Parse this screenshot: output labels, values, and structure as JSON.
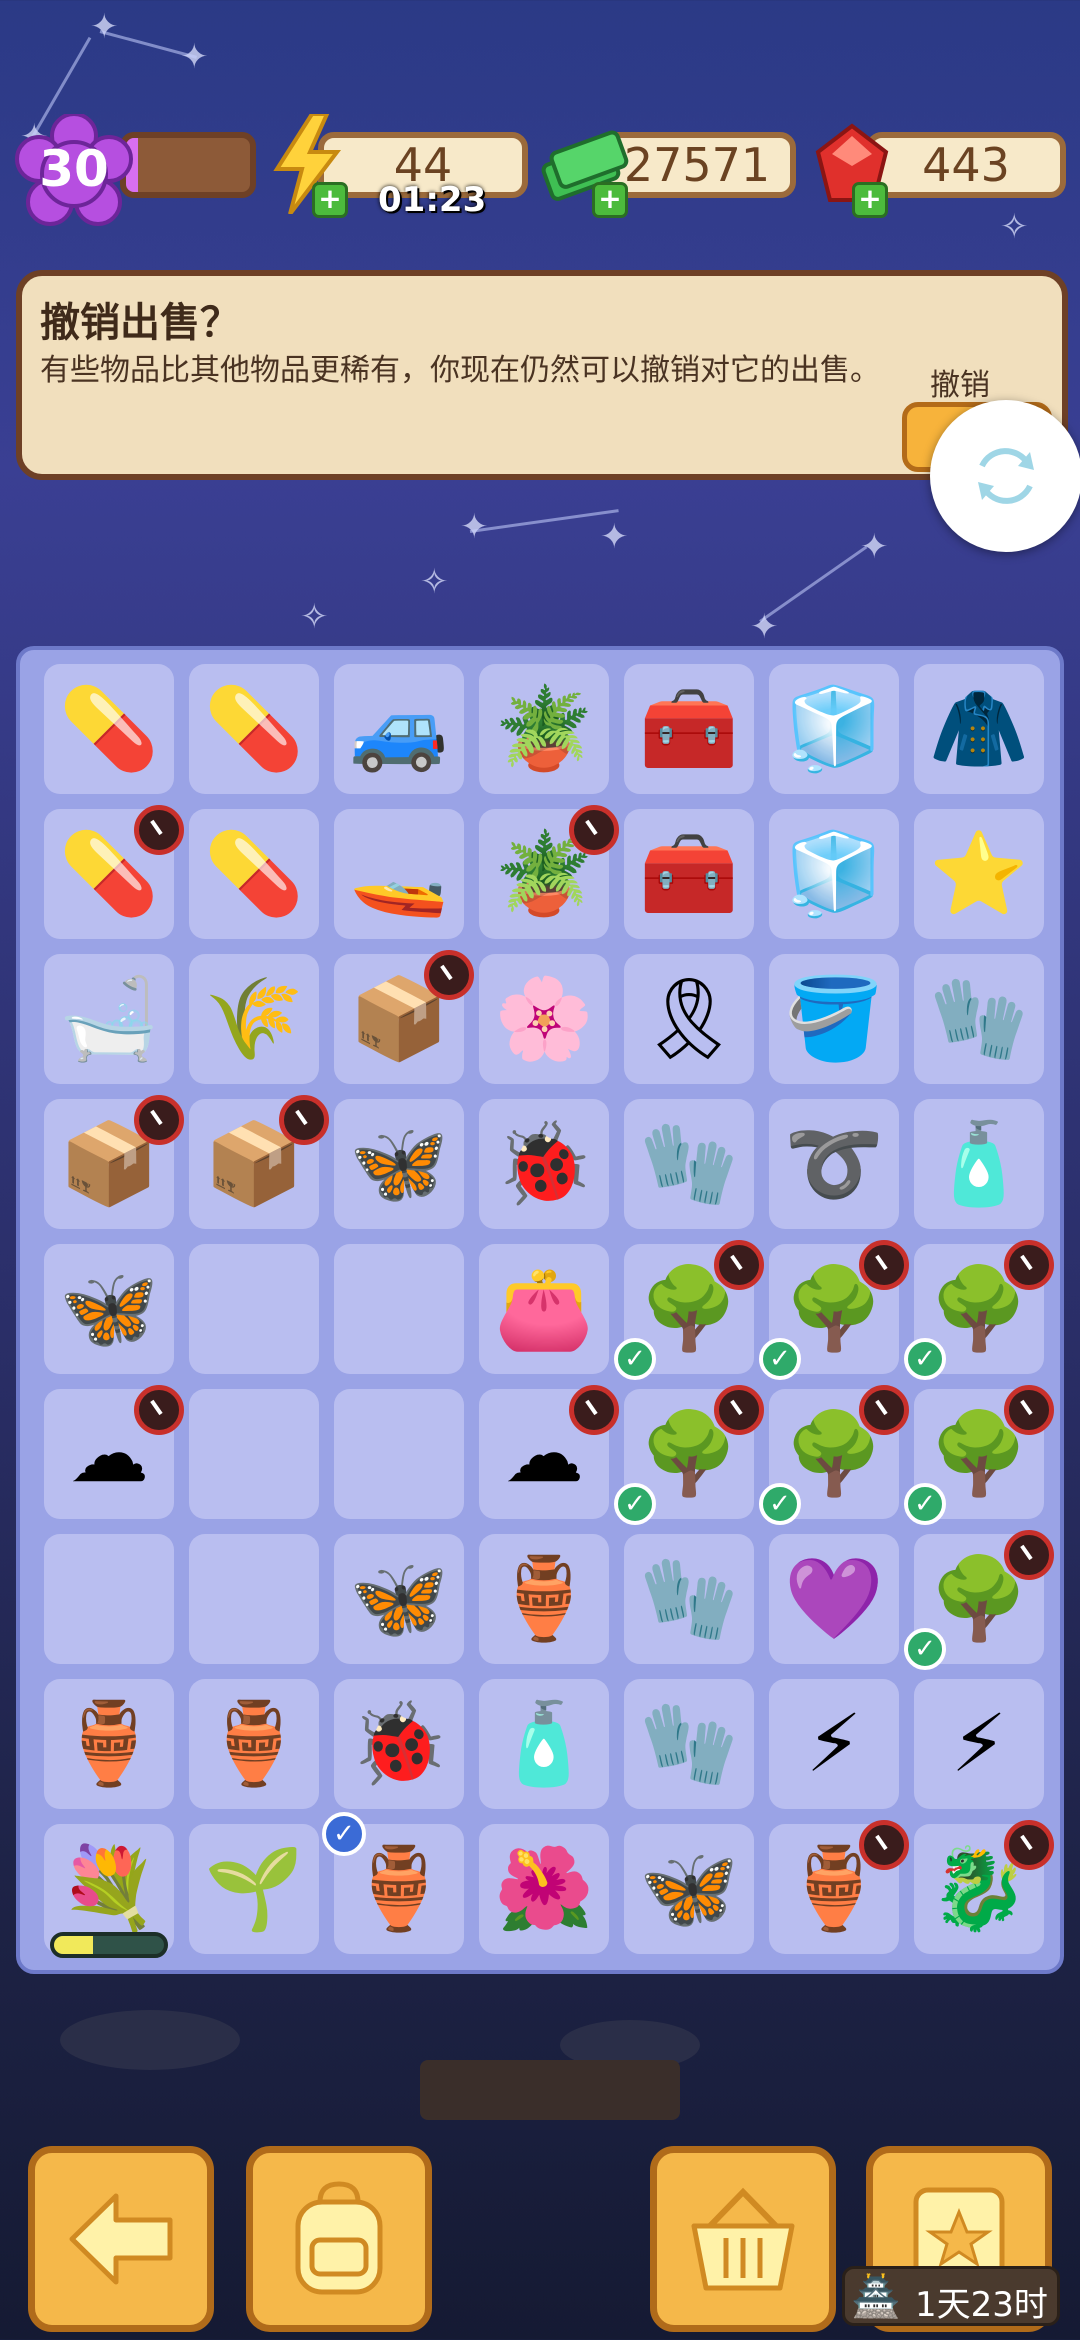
{
  "hud": {
    "level": "30",
    "level_progress_pct": 10,
    "energy": "44",
    "energy_timer": "01:23",
    "cash": "27571",
    "gems": "443"
  },
  "banner": {
    "title": "撤销出售？",
    "text": "有些物品比其他物品更稀有，你现在仍然可以撤销对它的出售。",
    "undo_label": "撤销"
  },
  "board": {
    "rows": [
      [
        {
          "item": "medkit-bottles"
        },
        {
          "item": "medkit-bottles"
        },
        {
          "item": "offroad-jeep"
        },
        {
          "item": "potted-plant"
        },
        {
          "item": "red-toolbox-open"
        },
        {
          "item": "yellow-cooler-open"
        },
        {
          "item": "brown-coat"
        }
      ],
      [
        {
          "item": "medkit-bottles",
          "clock": true
        },
        {
          "item": "medkit-bottles"
        },
        {
          "item": "jet-ski"
        },
        {
          "item": "empty-pot-seeds",
          "clock": true
        },
        {
          "item": "red-toolbox"
        },
        {
          "item": "yellow-cooler"
        },
        {
          "item": "purple-star"
        }
      ],
      [
        {
          "item": "bathtub-cabinet"
        },
        {
          "item": "seed-sack"
        },
        {
          "item": "pottery-crate",
          "clock": true
        },
        {
          "item": "flower-bed-glow"
        },
        {
          "item": "neck-pillow"
        },
        {
          "item": "yellow-bucket"
        },
        {
          "item": "red-gloves"
        }
      ],
      [
        {
          "item": "pottery-box",
          "clock": true
        },
        {
          "item": "pottery-crate-open",
          "clock": true
        },
        {
          "item": "purple-moth"
        },
        {
          "item": "ladybug"
        },
        {
          "item": "red-gloves"
        },
        {
          "item": "garden-hose"
        },
        {
          "item": "spray-bottle"
        }
      ],
      [
        {
          "item": "pale-moth"
        },
        {
          "item": "empty"
        },
        {
          "item": "empty"
        },
        {
          "item": "leather-wallet"
        },
        {
          "item": "bonsai-tree",
          "clock": true,
          "check": true
        },
        {
          "item": "bonsai-tree",
          "clock": true,
          "check": true
        },
        {
          "item": "bonsai-tree",
          "clock": true,
          "check": true
        }
      ],
      [
        {
          "item": "cotton-tree",
          "clock": true
        },
        {
          "item": "empty"
        },
        {
          "item": "empty"
        },
        {
          "item": "cotton-tree",
          "clock": true
        },
        {
          "item": "bonsai-tree",
          "clock": true,
          "check": true
        },
        {
          "item": "bonsai-tree",
          "clock": true,
          "check": true
        },
        {
          "item": "bonsai-tree",
          "clock": true,
          "check": true
        }
      ],
      [
        {
          "item": "empty"
        },
        {
          "item": "empty"
        },
        {
          "item": "pale-moth"
        },
        {
          "item": "vase"
        },
        {
          "item": "red-gloves"
        },
        {
          "item": "purple-blob"
        },
        {
          "item": "bonsai-tree",
          "clock": true,
          "check": true
        }
      ],
      [
        {
          "item": "vase-blue"
        },
        {
          "item": "vase-striped"
        },
        {
          "item": "ladybugs-pair"
        },
        {
          "item": "perfume-bottle"
        },
        {
          "item": "red-gloves"
        },
        {
          "item": "energy-coin-blue"
        },
        {
          "item": "energy-orb-red"
        }
      ],
      [
        {
          "item": "flower-bouquet",
          "progress_pct": 35
        },
        {
          "item": "sprout"
        },
        {
          "item": "vase-tall",
          "selected": true
        },
        {
          "item": "purple-flower-blob"
        },
        {
          "item": "purple-moth-large"
        },
        {
          "item": "vase-ornate",
          "clock": true
        },
        {
          "item": "dragon-pot",
          "clock": true
        }
      ]
    ]
  },
  "bottom": {
    "buttons": [
      "back-arrow",
      "backpack",
      "basket",
      "clipboard-star"
    ],
    "event_timer": "1天23时"
  },
  "icons": {
    "offroad-jeep": "🚙",
    "potted-plant": "🪴",
    "red-toolbox-open": "🧰",
    "red-toolbox": "🧰",
    "yellow-cooler-open": "🧊",
    "yellow-cooler": "🧊",
    "brown-coat": "🧥",
    "medkit-bottles": "💊",
    "jet-ski": "🚤",
    "empty-pot-seeds": "🪴",
    "purple-star": "⭐",
    "bathtub-cabinet": "🛁",
    "seed-sack": "🌾",
    "pottery-crate": "📦",
    "flower-bed-glow": "🌸",
    "neck-pillow": "🎗",
    "yellow-bucket": "🪣",
    "red-gloves": "🧤",
    "pottery-box": "📦",
    "pottery-crate-open": "📦",
    "purple-moth": "🦋",
    "ladybug": "🐞",
    "garden-hose": "➰",
    "spray-bottle": "🧴",
    "pale-moth": "🦋",
    "leather-wallet": "👛",
    "bonsai-tree": "🌳",
    "cotton-tree": "☁",
    "vase": "🏺",
    "purple-blob": "💜",
    "vase-blue": "🏺",
    "vase-striped": "🏺",
    "ladybugs-pair": "🐞",
    "perfume-bottle": "🧴",
    "energy-coin-blue": "⚡",
    "energy-orb-red": "⚡",
    "flower-bouquet": "💐",
    "sprout": "🌱",
    "vase-tall": "🏺",
    "purple-flower-blob": "🌺",
    "purple-moth-large": "🦋",
    "vase-ornate": "🏺",
    "dragon-pot": "🐉",
    "empty": ""
  },
  "colors": {
    "board_bg": "#9aa3e6",
    "cell_bg": "#b9bef0",
    "button_orange": "#f5b84a",
    "banner_bg": "#f1dfbd",
    "level_fill": "#d86ff0"
  }
}
